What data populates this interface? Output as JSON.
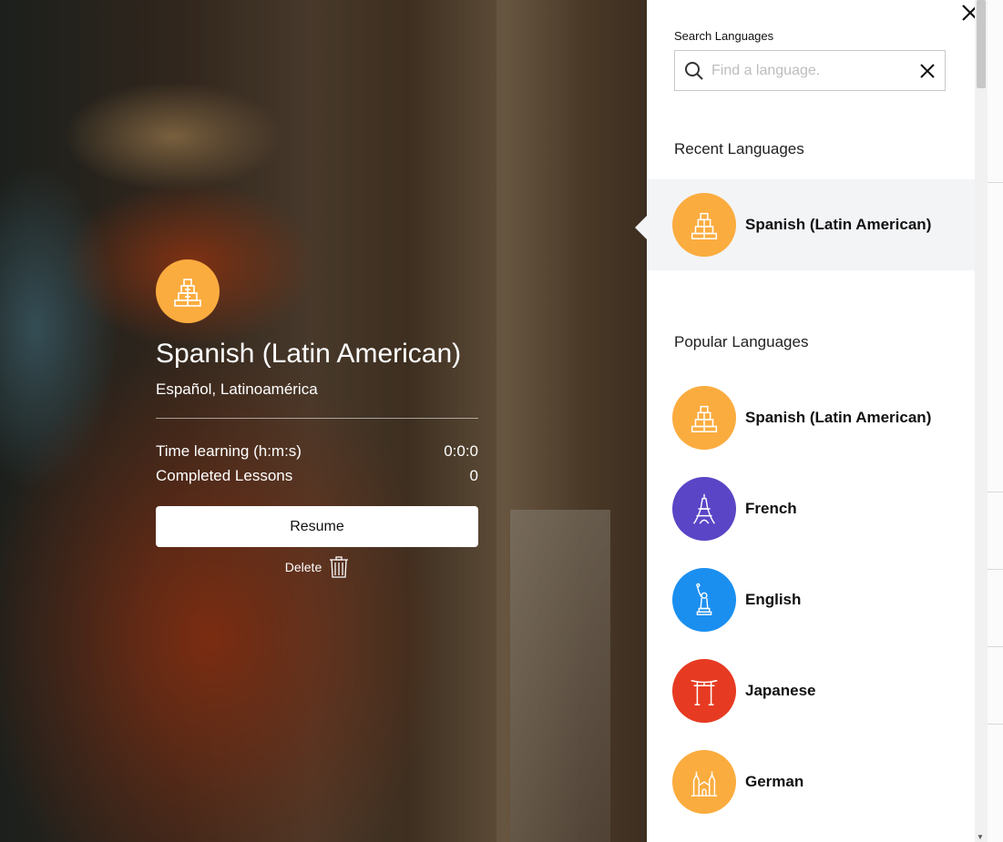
{
  "hero": {
    "title": "Spanish (Latin American)",
    "native_name": "Español, Latinoamérica",
    "stats": [
      {
        "label": "Time learning (h:m:s)",
        "value": "0:0:0"
      },
      {
        "label": "Completed Lessons",
        "value": "0"
      }
    ],
    "resume_label": "Resume",
    "delete_label": "Delete",
    "badge_color": "#fbac3f"
  },
  "panel": {
    "search_label": "Search Languages",
    "search_placeholder": "Find a language.",
    "recent_title": "Recent Languages",
    "recent": [
      {
        "name": "Spanish (Latin American)",
        "icon": "pyramid-icon",
        "color": "#fbac3f"
      }
    ],
    "popular_title": "Popular Languages",
    "popular": [
      {
        "name": "Spanish (Latin American)",
        "icon": "pyramid-icon",
        "color": "#fbac3f"
      },
      {
        "name": "French",
        "icon": "eiffel-tower-icon",
        "color": "#5a45c6"
      },
      {
        "name": "English",
        "icon": "statue-of-liberty-icon",
        "color": "#1b8ff0"
      },
      {
        "name": "Japanese",
        "icon": "torii-gate-icon",
        "color": "#e63b22"
      },
      {
        "name": "German",
        "icon": "cathedral-icon",
        "color": "#fbac3f"
      }
    ]
  }
}
